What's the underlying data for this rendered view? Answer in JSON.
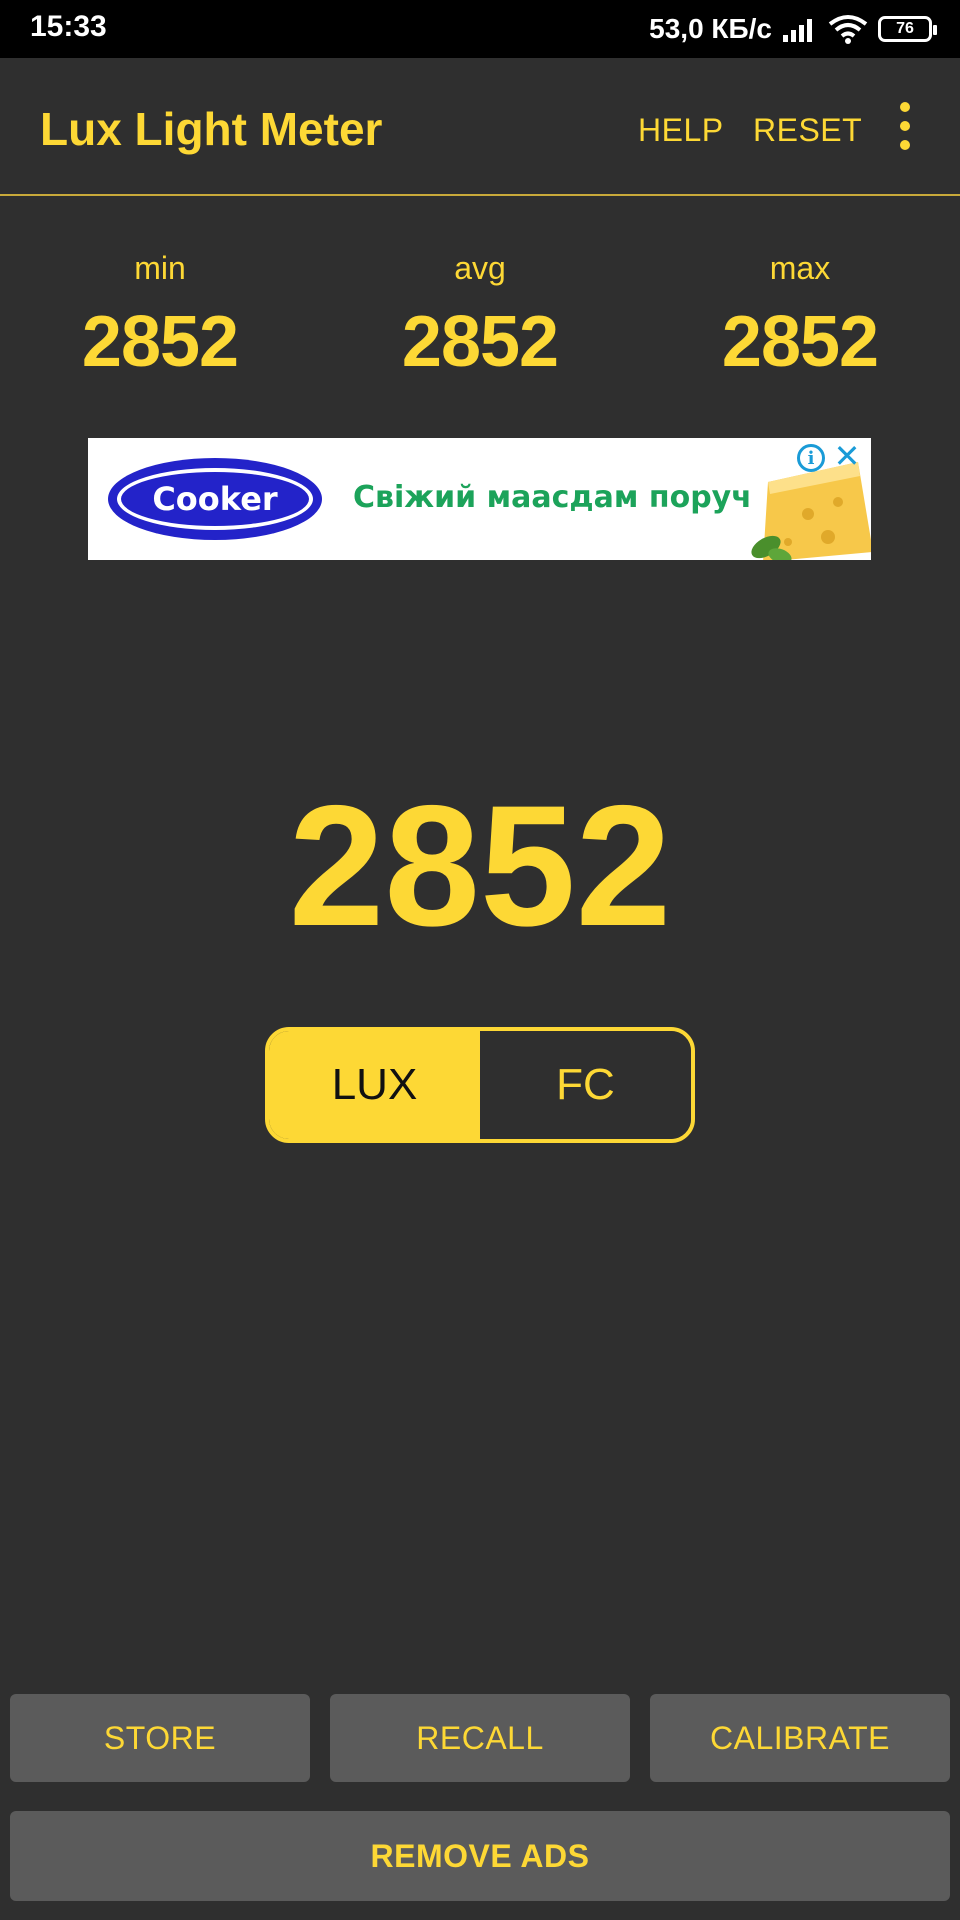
{
  "status_bar": {
    "time": "15:33",
    "network_speed": "53,0 КБ/с",
    "battery": "76"
  },
  "app_bar": {
    "title": "Lux Light Meter",
    "help_label": "HELP",
    "reset_label": "RESET",
    "overflow_icon": "more-vert-icon"
  },
  "stats": {
    "min_label": "min",
    "min_value": "2852",
    "avg_label": "avg",
    "avg_value": "2852",
    "max_label": "max",
    "max_value": "2852"
  },
  "ad": {
    "brand": "Cooker",
    "text": "Свіжий маасдам поруч",
    "info_icon": "info-icon",
    "close_icon": "close-icon"
  },
  "reading": {
    "value": "2852"
  },
  "unit_toggle": {
    "options": [
      "LUX",
      "FC"
    ],
    "selected": "LUX"
  },
  "buttons": {
    "store": "STORE",
    "recall": "RECALL",
    "calibrate": "CALIBRATE",
    "remove_ads": "REMOVE ADS"
  },
  "colors": {
    "accent": "#fdd835",
    "background": "#2f2f2f",
    "button_bg": "#5b5b5b"
  }
}
